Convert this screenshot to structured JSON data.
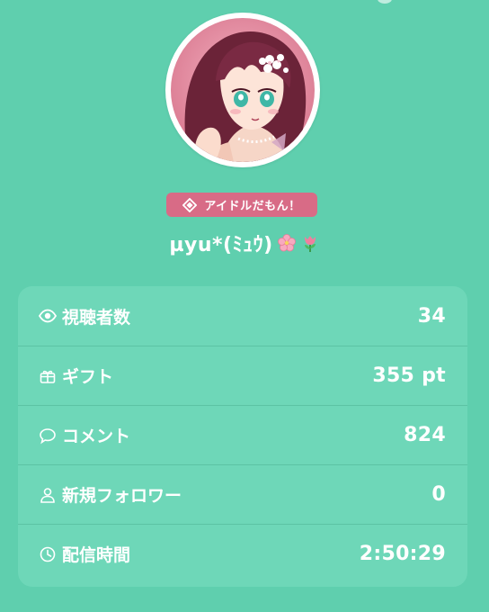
{
  "profile": {
    "badge_label": "アイドルだもん！",
    "username": "µyu*(ﾐｭｳ)",
    "avatar_icon": "avatar",
    "badge_icon": "diamond-icon",
    "emojis": [
      "cherry-blossom-icon",
      "tulip-icon"
    ]
  },
  "stats": [
    {
      "icon": "eye-icon",
      "label": "視聴者数",
      "value": "34"
    },
    {
      "icon": "gift-icon",
      "label": "ギフト",
      "value": "355 pt"
    },
    {
      "icon": "comment-icon",
      "label": "コメント",
      "value": "824"
    },
    {
      "icon": "person-icon",
      "label": "新規フォロワー",
      "value": "0"
    },
    {
      "icon": "clock-icon",
      "label": "配信時間",
      "value": "2:50:29"
    }
  ],
  "colors": {
    "background": "#5fcfae",
    "card": "#6ed7b8",
    "badge": "#d86b86",
    "text": "#ffffff"
  }
}
